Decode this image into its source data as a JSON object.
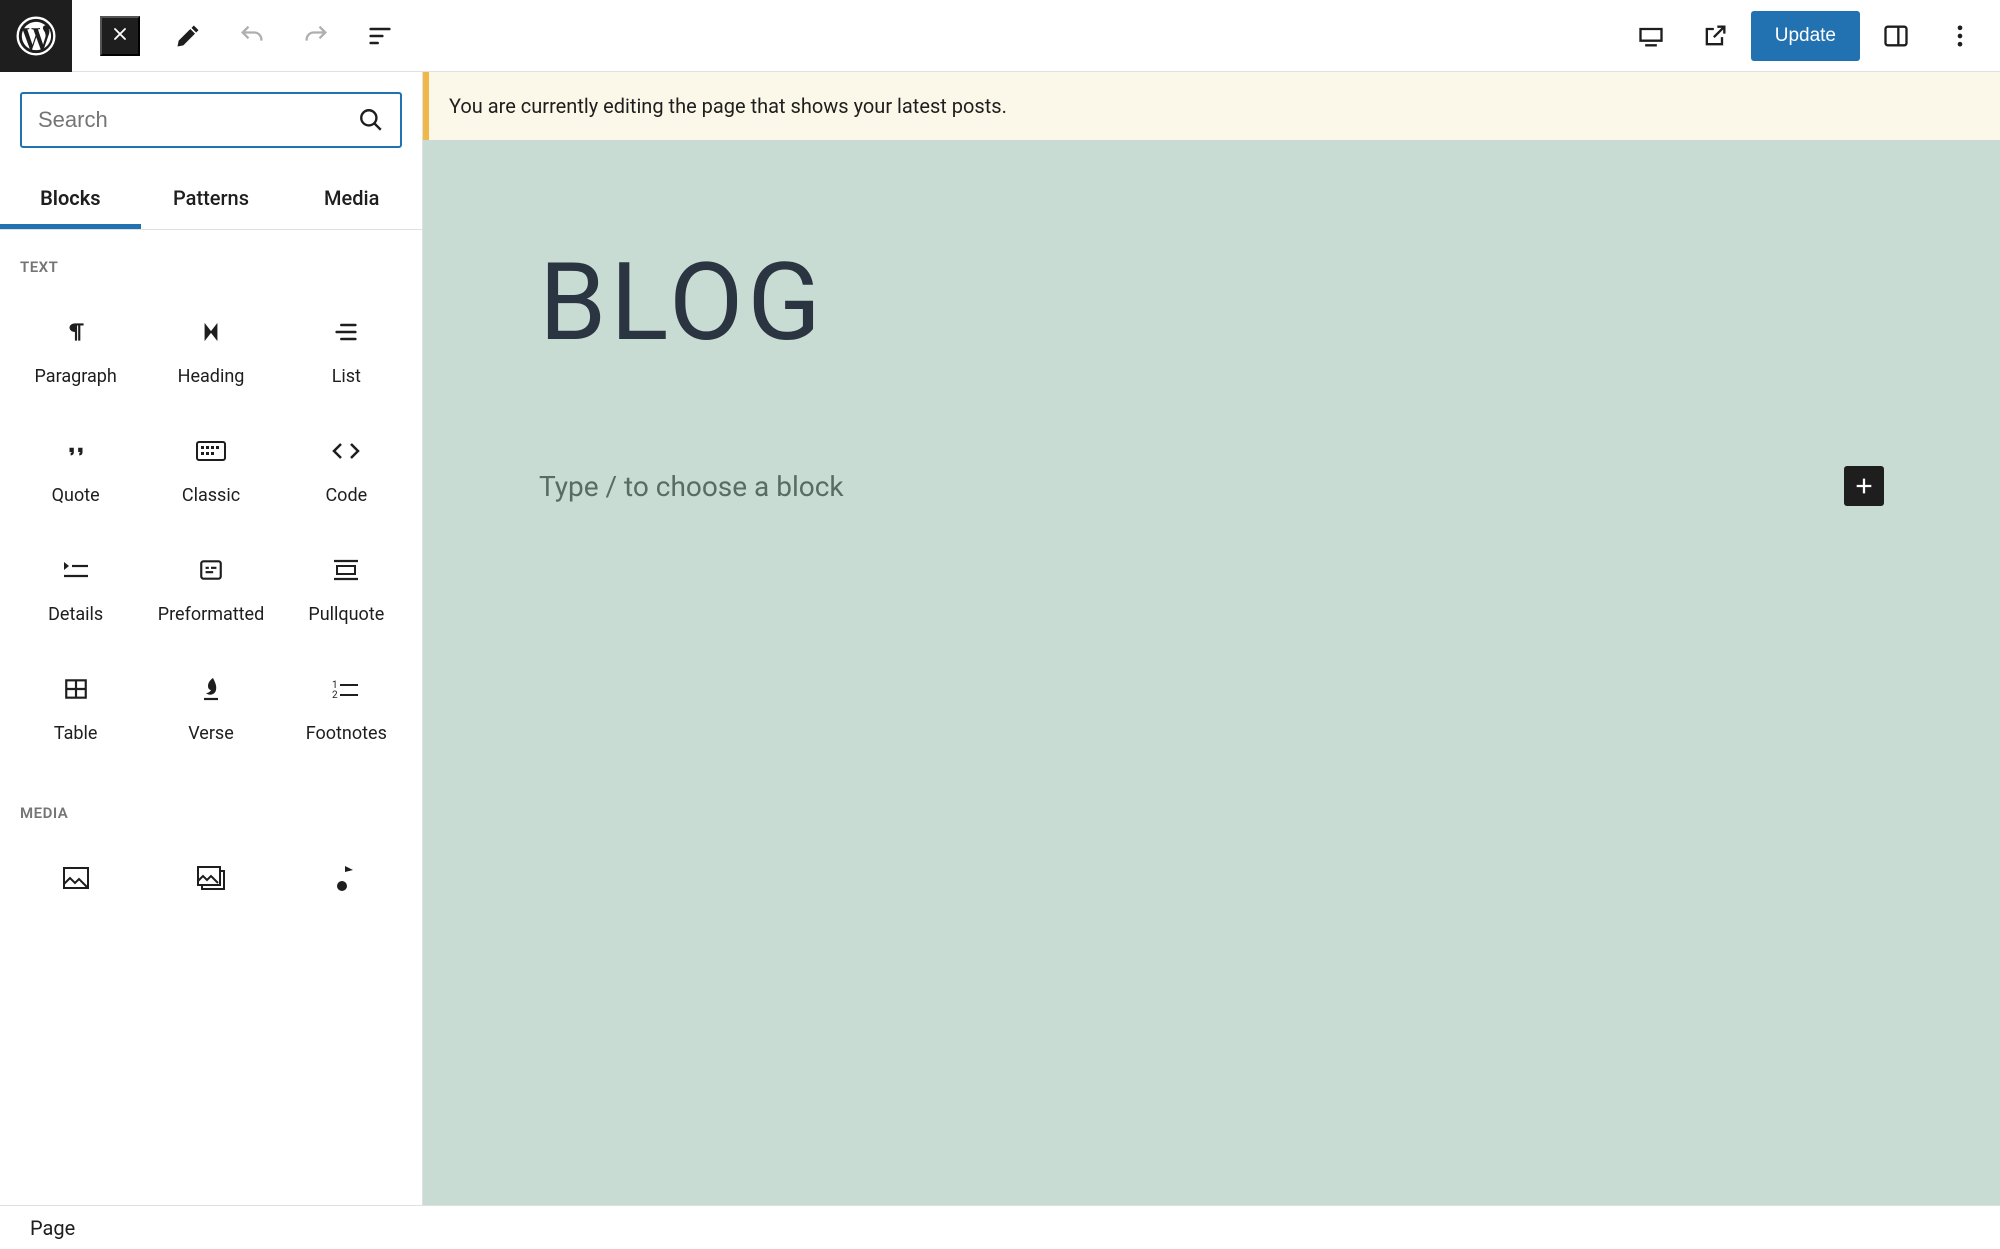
{
  "toolbar": {
    "update_label": "Update"
  },
  "sidebar": {
    "search_placeholder": "Search",
    "tabs": {
      "blocks": "Blocks",
      "patterns": "Patterns",
      "media": "Media"
    },
    "categories": {
      "text": {
        "label": "TEXT",
        "items": [
          {
            "label": "Paragraph"
          },
          {
            "label": "Heading"
          },
          {
            "label": "List"
          },
          {
            "label": "Quote"
          },
          {
            "label": "Classic"
          },
          {
            "label": "Code"
          },
          {
            "label": "Details"
          },
          {
            "label": "Preformatted"
          },
          {
            "label": "Pullquote"
          },
          {
            "label": "Table"
          },
          {
            "label": "Verse"
          },
          {
            "label": "Footnotes"
          }
        ]
      },
      "media": {
        "label": "MEDIA",
        "items": [
          {
            "label": ""
          },
          {
            "label": ""
          },
          {
            "label": ""
          }
        ]
      }
    }
  },
  "canvas": {
    "notice": "You are currently editing the page that shows your latest posts.",
    "page_title": "BLOG",
    "placeholder": "Type / to choose a block"
  },
  "footer": {
    "breadcrumb": "Page"
  }
}
